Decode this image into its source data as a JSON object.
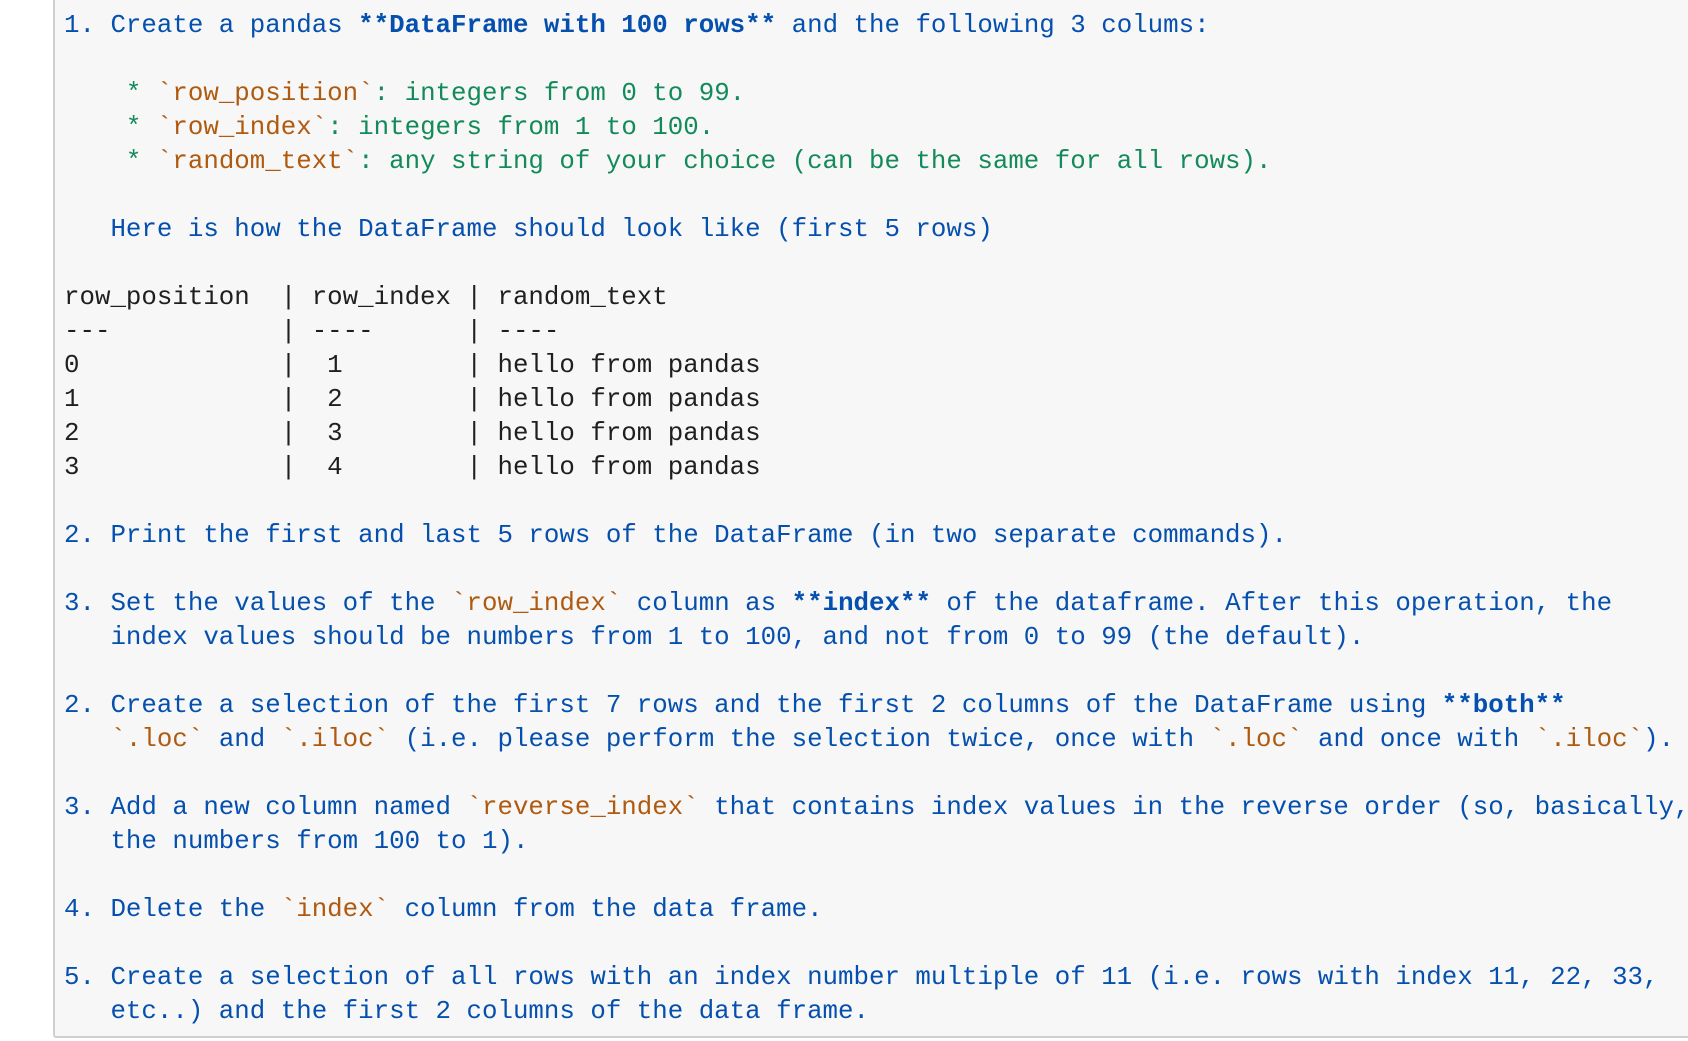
{
  "cell": {
    "type": "markdown-editor",
    "lines": [
      [
        {
          "t": "1. Create a pandas ",
          "s": "blue"
        },
        {
          "t": "**DataFrame with 100 rows**",
          "s": "bold"
        },
        {
          "t": " and the following 3 colums:",
          "s": "blue"
        }
      ],
      [],
      [
        {
          "t": "    * ",
          "s": "green"
        },
        {
          "t": "`row_position`",
          "s": "code"
        },
        {
          "t": ": integers from 0 to 99.",
          "s": "green"
        }
      ],
      [
        {
          "t": "    * ",
          "s": "green"
        },
        {
          "t": "`row_index`",
          "s": "code"
        },
        {
          "t": ": integers from 1 to 100.",
          "s": "green"
        }
      ],
      [
        {
          "t": "    * ",
          "s": "green"
        },
        {
          "t": "`random_text`",
          "s": "code"
        },
        {
          "t": ": any string of your choice (can be the same for all rows).",
          "s": "green"
        }
      ],
      [],
      [
        {
          "t": "   Here is how the DataFrame should look like (first 5 rows)",
          "s": "blue"
        }
      ],
      [],
      [
        {
          "t": "row_position  | row_index | random_text",
          "s": "plain"
        }
      ],
      [
        {
          "t": "---           | ----      | ----",
          "s": "plain"
        }
      ],
      [
        {
          "t": "0             |  1        | hello from pandas",
          "s": "plain"
        }
      ],
      [
        {
          "t": "1             |  2        | hello from pandas",
          "s": "plain"
        }
      ],
      [
        {
          "t": "2             |  3        | hello from pandas",
          "s": "plain"
        }
      ],
      [
        {
          "t": "3             |  4        | hello from pandas",
          "s": "plain"
        }
      ],
      [],
      [
        {
          "t": "2. Print the first and last 5 rows of the DataFrame (in two separate commands).",
          "s": "blue"
        }
      ],
      [],
      [
        {
          "t": "3. Set the values of the ",
          "s": "blue"
        },
        {
          "t": "`row_index`",
          "s": "code"
        },
        {
          "t": " column as ",
          "s": "blue"
        },
        {
          "t": "**index**",
          "s": "bold"
        },
        {
          "t": " of the dataframe. After this operation, the",
          "s": "blue"
        }
      ],
      [
        {
          "t": "   index values should be numbers from 1 to 100, and not from 0 to 99 (the default).",
          "s": "blue"
        }
      ],
      [],
      [
        {
          "t": "2. Create a selection of the first 7 rows and the first 2 columns of the DataFrame using ",
          "s": "blue"
        },
        {
          "t": "**both**",
          "s": "bold"
        }
      ],
      [
        {
          "t": "   ",
          "s": "blue"
        },
        {
          "t": "`.loc`",
          "s": "code"
        },
        {
          "t": " and ",
          "s": "blue"
        },
        {
          "t": "`.iloc`",
          "s": "code"
        },
        {
          "t": " (i.e. please perform the selection twice, once with ",
          "s": "blue"
        },
        {
          "t": "`.loc`",
          "s": "code"
        },
        {
          "t": " and once with ",
          "s": "blue"
        },
        {
          "t": "`.iloc`",
          "s": "code"
        },
        {
          "t": ").",
          "s": "blue"
        }
      ],
      [],
      [
        {
          "t": "3. Add a new column named ",
          "s": "blue"
        },
        {
          "t": "`reverse_index`",
          "s": "code"
        },
        {
          "t": " that contains index values in the reverse order (so, basically,",
          "s": "blue"
        }
      ],
      [
        {
          "t": "   the numbers from 100 to 1).",
          "s": "blue"
        }
      ],
      [],
      [
        {
          "t": "4. Delete the ",
          "s": "blue"
        },
        {
          "t": "`index`",
          "s": "code"
        },
        {
          "t": " column from the data frame.",
          "s": "blue"
        }
      ],
      [],
      [
        {
          "t": "5. Create a selection of all rows with an index number multiple of 11 (i.e. rows with index 11, 22, 33,",
          "s": "blue"
        }
      ],
      [
        {
          "t": "   etc..) and the first 2 columns of the data frame.",
          "s": "blue"
        }
      ]
    ]
  },
  "colors": {
    "text_blue": "#0550ae",
    "list_green": "#138a5a",
    "inline_code": "#b05a0f",
    "plain_text": "#1f1f1f",
    "cell_background": "#f7f7f7",
    "cell_border": "#cfcfcf"
  }
}
